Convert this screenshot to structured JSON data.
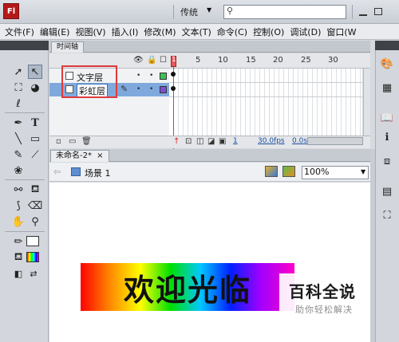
{
  "app": {
    "logo": "Fl",
    "workspace": "传统",
    "search": {
      "placeholder": "",
      "value": ""
    }
  },
  "menu": [
    "文件(F)",
    "编辑(E)",
    "视图(V)",
    "插入(I)",
    "修改(M)",
    "文本(T)",
    "命令(C)",
    "控制(O)",
    "调试(D)",
    "窗口(W"
  ],
  "timeline": {
    "tab_label": "时间轴",
    "frame_numbers": [
      "1",
      "5",
      "10",
      "15",
      "20",
      "25",
      "30"
    ],
    "playhead_frame": "1",
    "layers": [
      {
        "name": "文字层",
        "color": "#3fbf55"
      },
      {
        "name": "彩虹层",
        "color": "#7b4fd1"
      }
    ],
    "footer": {
      "frame": "1",
      "fps": "30.0fps",
      "time": "0.0s"
    }
  },
  "document": {
    "tab_label": "未命名-2*",
    "close_glyph": "×",
    "scene": "场景 1",
    "zoom": "100%"
  },
  "stage": {
    "text": "欢迎光临"
  },
  "watermark": {
    "title": "百科全说",
    "subtitle": "助你轻松解决"
  },
  "icons": {
    "tools": [
      "selection-icon",
      "subselection-icon",
      "free-transform-icon",
      "3d-rotation-icon",
      "lasso-icon",
      "pen-icon",
      "text-icon",
      "line-icon",
      "rectangle-icon",
      "pencil-icon",
      "brush-icon",
      "deco-icon",
      "bone-icon",
      "paint-bucket-icon",
      "eyedropper-icon",
      "eraser-icon",
      "hand-icon",
      "zoom-icon",
      "stroke-color-icon",
      "fill-color-icon",
      "swap-colors-icon"
    ]
  }
}
